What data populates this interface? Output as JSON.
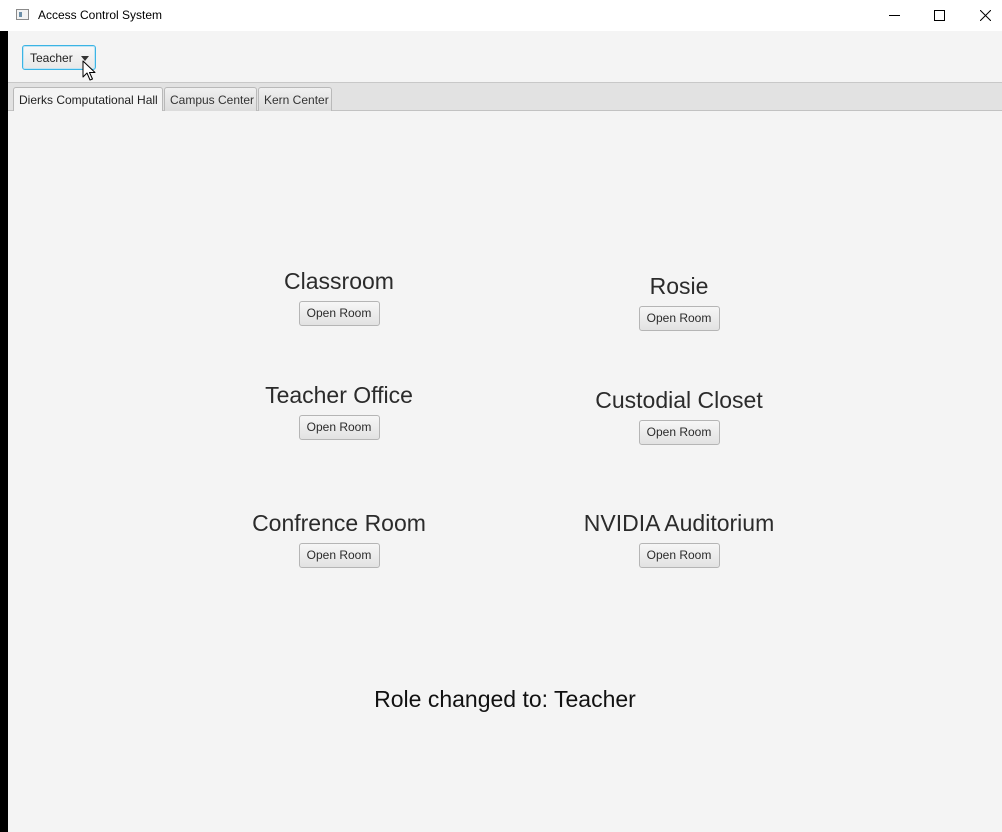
{
  "window": {
    "title": "Access Control System"
  },
  "toolbar": {
    "role_value": "Teacher"
  },
  "tabs": [
    {
      "label": "Dierks Computational Hall",
      "active": true
    },
    {
      "label": "Campus Center",
      "active": false
    },
    {
      "label": "Kern Center",
      "active": false
    }
  ],
  "rooms": [
    {
      "name": "Classroom",
      "button": "Open Room"
    },
    {
      "name": "Rosie",
      "button": "Open Room"
    },
    {
      "name": "Teacher Office",
      "button": "Open Room"
    },
    {
      "name": "Custodial Closet",
      "button": "Open Room"
    },
    {
      "name": "Confrence Room",
      "button": "Open Room"
    },
    {
      "name": "NVIDIA Auditorium",
      "button": "Open Room"
    }
  ],
  "status": "Role changed to: Teacher",
  "colors": {
    "accent": "#3bb4e4",
    "background": "#f4f4f4"
  }
}
